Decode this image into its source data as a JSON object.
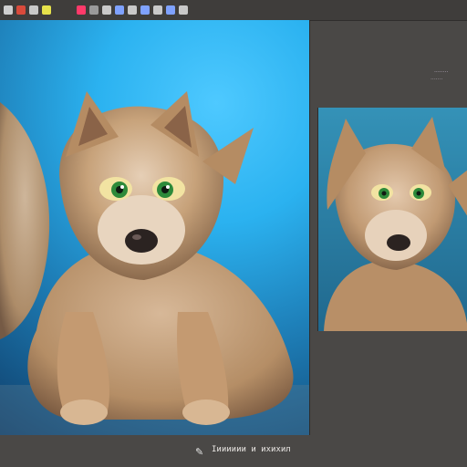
{
  "toolbar": {
    "tools": [
      {
        "name": "brush-icon",
        "color": "#cfcfcf"
      },
      {
        "name": "red-mark-icon",
        "color": "#d94a3b"
      },
      {
        "name": "layers-icon",
        "color": "#c9c9c9"
      },
      {
        "name": "color-swatch-icon",
        "color": "#e6e24b"
      },
      {
        "name": "pen-tool-icon",
        "color": "#ff3a6a"
      },
      {
        "name": "transform-icon",
        "color": "#9a9a9a"
      },
      {
        "name": "select-icon",
        "color": "#c9c9c9"
      },
      {
        "name": "eye-icon",
        "color": "#7fa2ff"
      },
      {
        "name": "gradient-icon",
        "color": "#c9c9c9"
      },
      {
        "name": "eraser-icon",
        "color": "#7fa2ff"
      },
      {
        "name": "crop-icon",
        "color": "#c9c9c9"
      },
      {
        "name": "zoom-icon",
        "color": "#7fa2ff"
      },
      {
        "name": "settings-icon",
        "color": "#c9c9c9"
      }
    ]
  },
  "status": {
    "text": "Іииииии и   ихихил"
  },
  "panel": {
    "label1": "········",
    "label2": "·······"
  },
  "colors": {
    "background": "#4a4846",
    "fur": "#c7a27a",
    "eye": "#2d8a3a"
  }
}
